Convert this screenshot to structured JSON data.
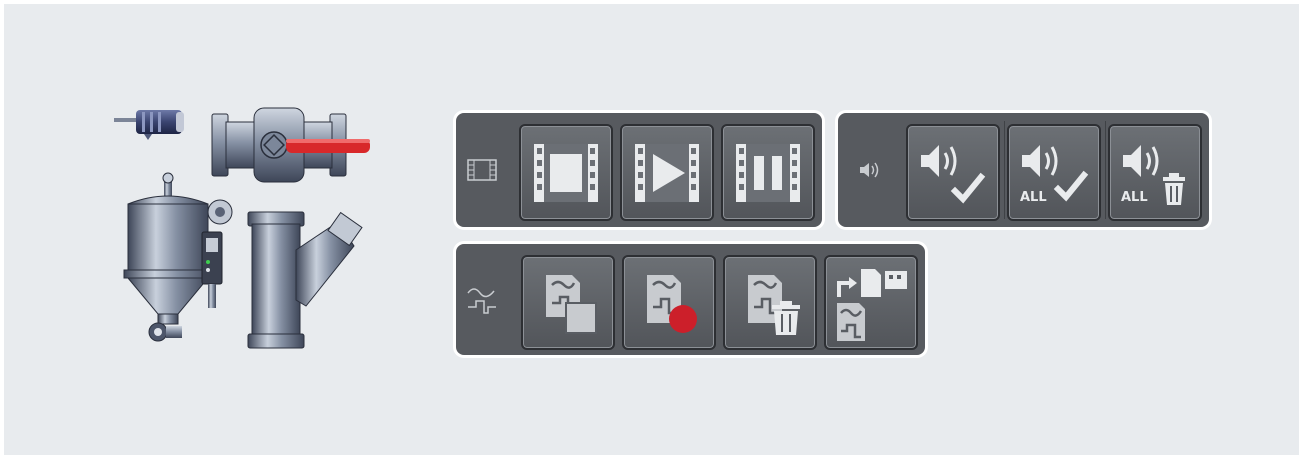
{
  "icons": {
    "equipment": [
      "motor-icon",
      "ball-valve-icon",
      "hopper-dryer-icon",
      "y-strainer-icon"
    ],
    "video_panel": {
      "tag": "film-strip-icon",
      "buttons": [
        "video-stop-icon",
        "video-play-icon",
        "video-pause-icon"
      ]
    },
    "sound_panel": {
      "tag": "speaker-icon",
      "buttons": [
        "sound-acknowledge-icon",
        "sound-acknowledge-all-icon",
        "sound-delete-all-icon"
      ],
      "all_label": "ALL"
    },
    "curve_panel": {
      "tag": "waveform-icon",
      "buttons": [
        "curve-copy-icon",
        "curve-record-icon",
        "curve-delete-icon",
        "curve-export-icon"
      ]
    }
  },
  "colors": {
    "panel": "#575a5f",
    "icon": "#e9ebed",
    "valve_handle": "#d8282a",
    "record_dot": "#cc1f2a",
    "background": "#e8ebee"
  }
}
